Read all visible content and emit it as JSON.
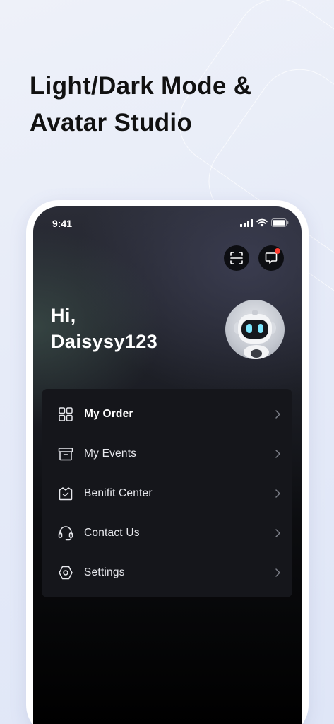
{
  "headline": {
    "line1": "Light/Dark Mode &",
    "line2": "Avatar Studio"
  },
  "status_bar": {
    "time": "9:41"
  },
  "header": {
    "greeting_line1": "Hi,",
    "greeting_line2": "Daisysy123",
    "scan_icon": "scan-icon",
    "message_icon": "message-icon",
    "has_notification": true
  },
  "menu": {
    "items": [
      {
        "label": "My Order",
        "icon": "grid-icon",
        "active": true
      },
      {
        "label": "My Events",
        "icon": "box-icon",
        "active": false
      },
      {
        "label": "Benifit Center",
        "icon": "benefit-icon",
        "active": false
      },
      {
        "label": "Contact Us",
        "icon": "headset-icon",
        "active": false
      },
      {
        "label": "Settings",
        "icon": "settings-icon",
        "active": false
      }
    ]
  },
  "colors": {
    "background": "#e6ebf8",
    "screen": "#1c1e25",
    "card": "#15161b",
    "notification": "#ff3b30",
    "text_primary": "#ffffff"
  }
}
